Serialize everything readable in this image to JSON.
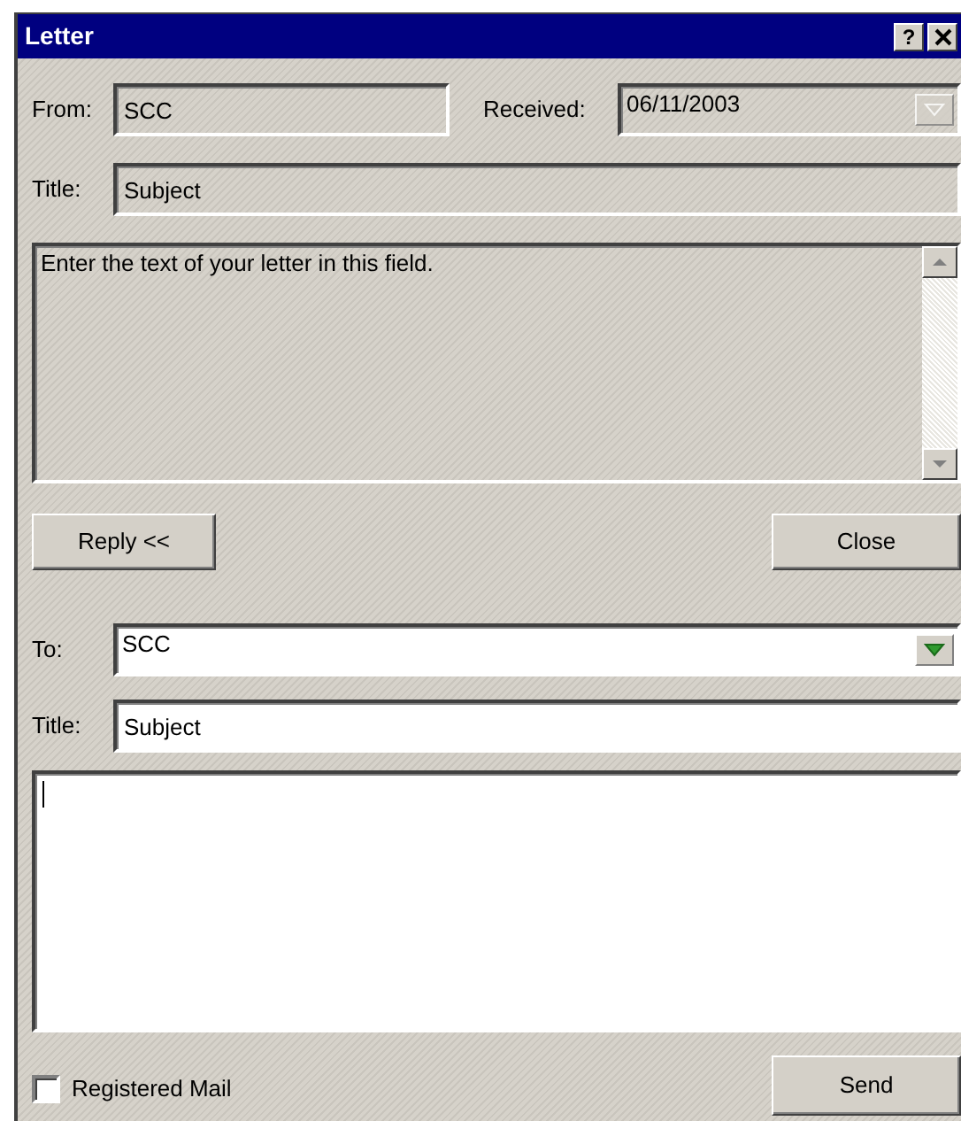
{
  "window": {
    "title": "Letter",
    "help_button": "?"
  },
  "received_letter": {
    "from": {
      "label": "From:",
      "value": "SCC"
    },
    "received": {
      "label": "Received:",
      "value": "06/11/2003",
      "disabled": true
    },
    "title": {
      "label": "Title:",
      "value": "Subject"
    },
    "body": "Enter the text of your letter in this field."
  },
  "buttons": [
    {
      "label": "Reply <<"
    },
    {
      "label": "Close"
    }
  ],
  "reply": {
    "to": {
      "label": "To:",
      "value": "SCC",
      "disabled": false
    },
    "title": {
      "label": "Title:",
      "value": "Subject"
    },
    "registered_mail": {
      "label": "Registered Mail",
      "checked": false
    },
    "send_button": {
      "label": "Send"
    }
  }
}
